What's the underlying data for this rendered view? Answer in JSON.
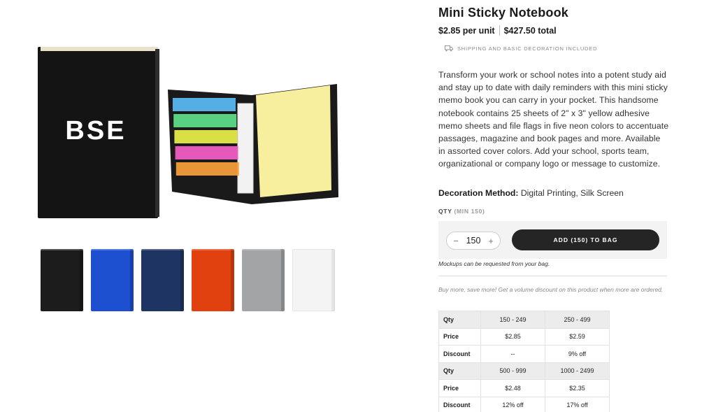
{
  "product": {
    "title": "Mini Sticky Notebook",
    "price_unit": "$2.85 per unit",
    "price_total": "$427.50 total",
    "shipping_note": "SHIPPING AND BASIC DECORATION INCLUDED",
    "description": "Transform your work or school notes into a potent study aid and stay up to date with daily reminders with this mini sticky memo book you can carry in your pocket. This handsome notebook contains 25 sheets of 2\" x 3\" yellow adhesive memo sheets and file flags in five neon colors to accentuate passages, magazine and book pages and more. Available in assorted cover colors. Add your school, sports team, organizational or company logo or message to customize.",
    "decoration_label": "Decoration Method:",
    "decoration_value": "Digital Printing, Silk Screen",
    "logo_text": "BSE"
  },
  "purchase": {
    "qty_label": "QTY",
    "qty_min": "(MIN 150)",
    "qty_value": "150",
    "minus": "−",
    "plus": "+",
    "add_button": "ADD (150) TO BAG",
    "mockups_note": "Mockups can be requested from your bag.",
    "buy_more": "Buy more, save more! Get a volume discount on this product when more are ordered."
  },
  "swatches": [
    {
      "name": "black",
      "color": "#1c1c1c"
    },
    {
      "name": "blue",
      "color": "#1d4fd1"
    },
    {
      "name": "navy",
      "color": "#1e3563"
    },
    {
      "name": "orange",
      "color": "#e0410f"
    },
    {
      "name": "gray",
      "color": "#a3a4a6"
    },
    {
      "name": "white",
      "color": "#f4f4f4"
    }
  ],
  "tiers": {
    "labels": {
      "qty": "Qty",
      "price": "Price",
      "discount": "Discount"
    },
    "groups": [
      {
        "qty": [
          "150 - 249",
          "250 - 499"
        ],
        "price": [
          "$2.85",
          "$2.59"
        ],
        "discount": [
          "--",
          "9% off"
        ]
      },
      {
        "qty": [
          "500 - 999",
          "1000 - 2499"
        ],
        "price": [
          "$2.48",
          "$2.35"
        ],
        "discount": [
          "12% off",
          "17% off"
        ]
      }
    ]
  },
  "colors": {
    "flags": [
      "#5bbcf5",
      "#5fe08a",
      "#e9f049",
      "#f65ec8",
      "#f9a23a"
    ],
    "memo_pad": "#f7ef9e",
    "button": "#252525"
  }
}
